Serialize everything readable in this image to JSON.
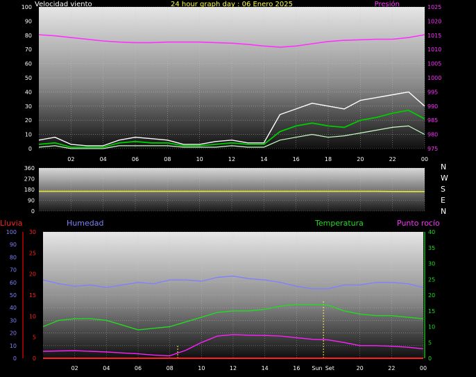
{
  "chart_data": [
    {
      "type": "line",
      "panel": "wind_pressure",
      "title": "24 hour graph day : 06 Enero 2025",
      "left_label": "Velocidad viento",
      "right_label": "Presión",
      "ylim_left": [
        0,
        100
      ],
      "ylim_right": [
        975,
        1025
      ],
      "y_ticks_left": [
        "0",
        "10",
        "20",
        "30",
        "40",
        "50",
        "60",
        "70",
        "80",
        "90",
        "100"
      ],
      "y_ticks_right": [
        "975",
        "980",
        "985",
        "990",
        "995",
        "1000",
        "1005",
        "1010",
        "1015",
        "1020",
        "1025"
      ],
      "x_ticks": [
        "02",
        "04",
        "06",
        "08",
        "10",
        "12",
        "14",
        "16",
        "18",
        "20",
        "22",
        "00"
      ],
      "x_hours": [
        0,
        1,
        2,
        3,
        4,
        5,
        6,
        7,
        8,
        9,
        10,
        11,
        12,
        13,
        14,
        15,
        16,
        17,
        18,
        19,
        20,
        21,
        22,
        23,
        24
      ],
      "pressure": [
        1015.2,
        1014.8,
        1014.2,
        1013.6,
        1013.0,
        1012.6,
        1012.4,
        1012.4,
        1012.6,
        1012.6,
        1012.6,
        1012.4,
        1012.2,
        1011.8,
        1011.2,
        1010.8,
        1011.2,
        1012.0,
        1012.8,
        1013.2,
        1013.4,
        1013.6,
        1013.6,
        1014.2,
        1015.2
      ],
      "gust": [
        6,
        8,
        3,
        2,
        2,
        6,
        8,
        7,
        6,
        3,
        3,
        5,
        6,
        4,
        4,
        24,
        28,
        32,
        30,
        28,
        34,
        36,
        38,
        40,
        30
      ],
      "wind_avg": [
        3,
        4,
        1,
        1,
        1,
        4,
        5,
        4,
        4,
        2,
        2,
        3,
        4,
        3,
        3,
        12,
        16,
        18,
        16,
        15,
        20,
        22,
        25,
        27,
        21
      ],
      "wind_min": [
        1,
        2,
        0,
        0,
        0,
        2,
        2,
        2,
        2,
        1,
        1,
        1,
        2,
        1,
        1,
        6,
        8,
        10,
        8,
        9,
        11,
        13,
        15,
        16,
        10
      ],
      "colors": {
        "pressure": "#ff30ff",
        "gust": "#ffffff",
        "wind_avg": "#00cc00",
        "wind_min": "#c8ffc8"
      }
    },
    {
      "type": "line",
      "panel": "wind_direction",
      "ylim": [
        0,
        360
      ],
      "y_ticks": [
        "0",
        "90",
        "180",
        "270",
        "360"
      ],
      "compass_labels": [
        "N",
        "W",
        "S",
        "E",
        "N"
      ],
      "direction": [
        165,
        165,
        165,
        165,
        165,
        165,
        165,
        165,
        165,
        165,
        165,
        165,
        165,
        165,
        165,
        165,
        165,
        165,
        165,
        165,
        165,
        165,
        164,
        163,
        163
      ],
      "colors": {
        "direction": "#e8e830"
      }
    },
    {
      "type": "line",
      "panel": "temp_hum",
      "labels": {
        "rain": "Lluvia",
        "humidity": "Humedad",
        "temperature": "Temperatura",
        "dewpoint": "Punto rocío"
      },
      "y_ticks_humidity": [
        "0",
        "10",
        "20",
        "30",
        "40",
        "50",
        "60",
        "70",
        "80",
        "90",
        "100"
      ],
      "y_ticks_rain": [
        "0",
        "5",
        "10",
        "15",
        "20",
        "25",
        "30"
      ],
      "y_ticks_temp": [
        "0",
        "5",
        "10",
        "15",
        "20",
        "25",
        "30",
        "35",
        "40"
      ],
      "x_ticks": [
        "02",
        "04",
        "06",
        "08",
        "10",
        "12",
        "14",
        "16",
        "Sun",
        "Set",
        "20",
        "22",
        "00"
      ],
      "sun_label": "Sun",
      "set_label": "Set",
      "sunrise_hour": 8.5,
      "sunset_hour": 17.7,
      "humidity": [
        62,
        59,
        57,
        58,
        56,
        58,
        60,
        59,
        62,
        62,
        61,
        64,
        65,
        63,
        62,
        60,
        57,
        55,
        55,
        58,
        58,
        60,
        60,
        59,
        56
      ],
      "temperature": [
        10,
        12,
        12.5,
        12.5,
        12,
        10.5,
        9,
        9.5,
        10,
        11.5,
        13,
        14.5,
        15,
        15,
        15.5,
        16.5,
        17,
        17,
        16.8,
        15,
        14,
        13.5,
        13.5,
        13,
        12.5
      ],
      "dewpoint": [
        2.2,
        2.3,
        2.4,
        2.2,
        2.0,
        1.7,
        1.4,
        1.0,
        0.8,
        2.5,
        5.0,
        7.0,
        7.5,
        7.3,
        7.2,
        7.0,
        6.5,
        6.0,
        5.8,
        5.0,
        4.0,
        4.0,
        3.8,
        3.5,
        3.0
      ],
      "rain": [
        0,
        0,
        0,
        0,
        0,
        0,
        0,
        0,
        0,
        0,
        0,
        0,
        0,
        0,
        0,
        0,
        0,
        0,
        0,
        0,
        0,
        0,
        0,
        0,
        0
      ],
      "colors": {
        "humidity": "#8080ff",
        "temperature": "#20dd20",
        "dewpoint": "#ff20ff",
        "rain": "#ff2020"
      }
    }
  ]
}
